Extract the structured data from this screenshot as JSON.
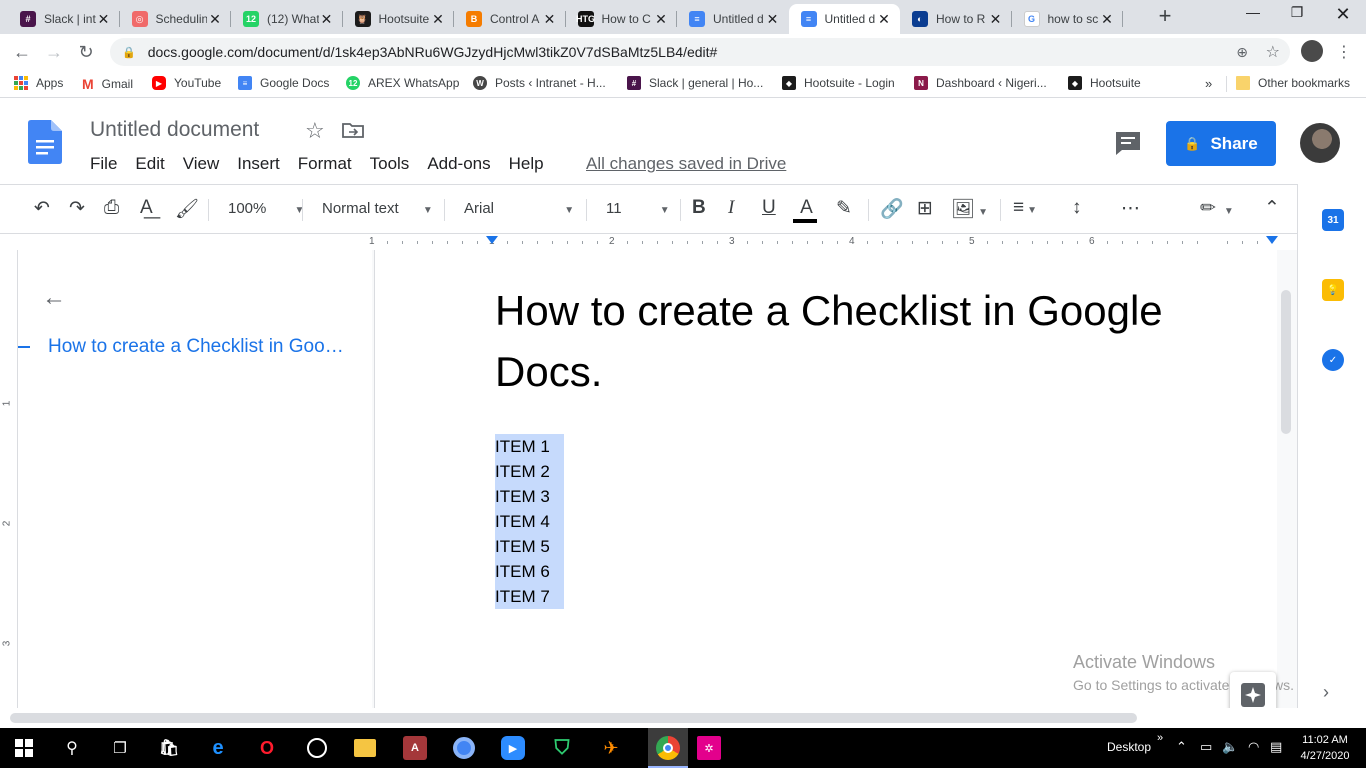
{
  "browser": {
    "tabs": [
      {
        "title": "Slack | int",
        "fav_color": "#4a154b",
        "fav_glyph": "#"
      },
      {
        "title": "Schedulin",
        "fav_color": "#f06a6a",
        "fav_glyph": "◎"
      },
      {
        "title": "(12) What",
        "fav_color": "#25d366",
        "fav_glyph": "12"
      },
      {
        "title": "Hootsuite",
        "fav_color": "#1c1c1c",
        "fav_glyph": "🦉"
      },
      {
        "title": "Control A",
        "fav_color": "#f57c00",
        "fav_glyph": "B"
      },
      {
        "title": "How to C",
        "fav_color": "#111111",
        "fav_glyph": "HTG"
      },
      {
        "title": "Untitled d",
        "fav_color": "#4285f4",
        "fav_glyph": "≡"
      },
      {
        "title": "Untitled d",
        "fav_color": "#4285f4",
        "fav_glyph": "≡"
      },
      {
        "title": "How to R",
        "fav_color": "#0b3d91",
        "fav_glyph": "◐"
      },
      {
        "title": "how to sc",
        "fav_color": "#ffffff",
        "fav_glyph": "G"
      }
    ],
    "active_tab": 7,
    "url": "docs.google.com/document/d/1sk4ep3AbNRu6WGJzydHjcMwl3tikZ0V7dSBaMtz5LB4/edit#",
    "bookmarks": [
      {
        "label": "Apps",
        "color": "#ea4335"
      },
      {
        "label": "Gmail",
        "color": "#ea4335"
      },
      {
        "label": "YouTube",
        "color": "#ff0000"
      },
      {
        "label": "Google Docs",
        "color": "#4285f4"
      },
      {
        "label": "AREX WhatsApp",
        "color": "#25d366"
      },
      {
        "label": "Posts ‹ Intranet - H...",
        "color": "#464646"
      },
      {
        "label": "Slack | general | Ho...",
        "color": "#4a154b"
      },
      {
        "label": "Hootsuite - Login",
        "color": "#1c1c1c"
      },
      {
        "label": "Dashboard ‹ Nigeri...",
        "color": "#8b1a4a"
      },
      {
        "label": "Hootsuite",
        "color": "#1c1c1c"
      }
    ],
    "bookmarks_overflow": "»",
    "other_bookmarks": "Other bookmarks"
  },
  "docs": {
    "title": "Untitled document",
    "menu": [
      "File",
      "Edit",
      "View",
      "Insert",
      "Format",
      "Tools",
      "Add-ons",
      "Help"
    ],
    "saved_status": "All changes saved in Drive",
    "share_label": "Share",
    "toolbar": {
      "zoom": "100%",
      "style": "Normal text",
      "font": "Arial",
      "size": "11"
    },
    "ruler_numbers": [
      "1",
      "1",
      "2",
      "3",
      "4",
      "5",
      "6"
    ],
    "vruler_numbers": [
      "1",
      "2",
      "3"
    ],
    "outline_item": "How to create a Checklist in Google Docs.",
    "heading": "How to create a Checklist in Google Docs.",
    "items": [
      "ITEM 1",
      "ITEM 2",
      "ITEM 3",
      "ITEM 4",
      "ITEM 5",
      "ITEM 6",
      "ITEM 7"
    ],
    "side_panel": {
      "calendar_day": "31"
    }
  },
  "watermark": {
    "line1": "Activate Windows",
    "line2": "Go to Settings to activate Windows."
  },
  "taskbar": {
    "desktop_label": "Desktop",
    "time": "11:02 AM",
    "date": "4/27/2020"
  }
}
